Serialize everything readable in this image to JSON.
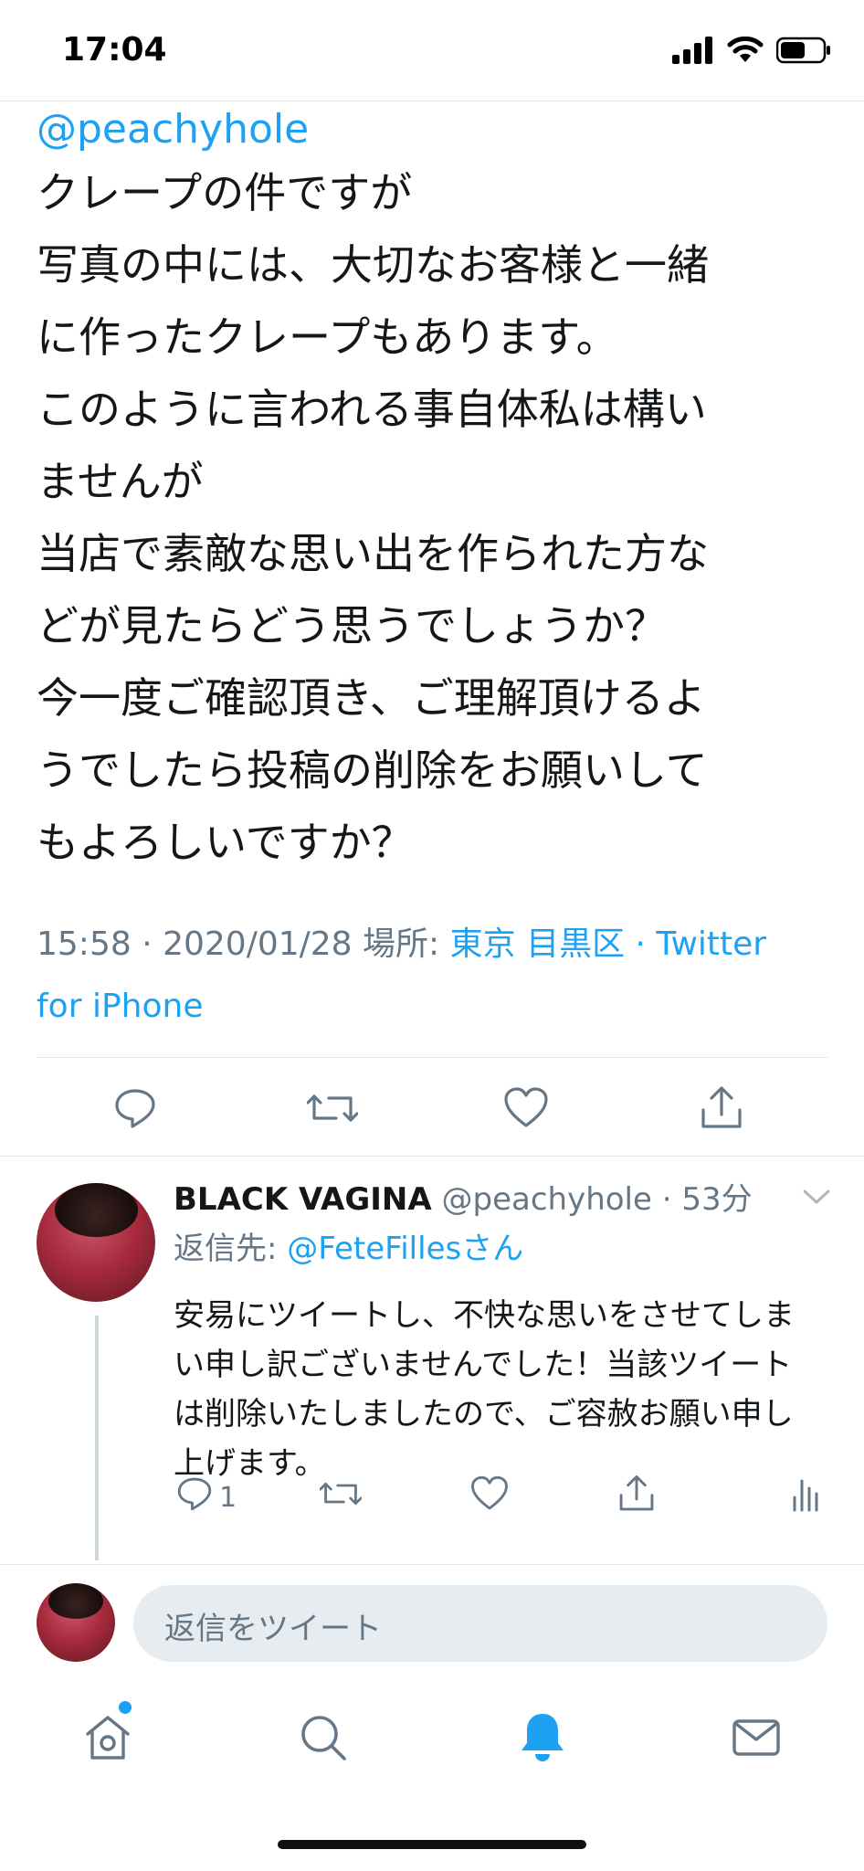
{
  "status_bar": {
    "time": "17:04",
    "signal_icon": "cellular-signal-icon",
    "wifi_icon": "wifi-icon",
    "battery_icon": "battery-icon"
  },
  "tweet": {
    "mention": "@peachyhole",
    "text": "クレープの件ですが\n写真の中には、大切なお客様と一緒\nに作ったクレープもあります。\nこのように言われる事自体私は構い\nませんが\n当店で素敵な思い出を作られた方な\nどが見たらどう思うでしょうか？\n今一度ご確認頂き、ご理解頂けるよ\nうでしたら投稿の削除をお願いして\nもよろしいですか？",
    "timestamp": "15:58 · 2020/01/28",
    "location_prefix": "場所:",
    "location": "東京 目黒区",
    "source": "· Twitter for iPhone",
    "actions": {
      "reply_icon": "reply-icon",
      "retweet_icon": "retweet-icon",
      "like_icon": "like-icon",
      "share_icon": "share-icon"
    }
  },
  "reply": {
    "name": "BLACK VAGINA",
    "handle": "@peachyhole",
    "time": "· 53分",
    "reply_to_prefix": "返信先:",
    "reply_to_handle": "@FeteFillesさん",
    "text": "安易にツイートし、不快な思いをさせてしま\nい申し訳ございませんでした！当該ツイート\nは削除いたしましたので、ご容赦お願い申し\n上げます。",
    "reply_count": "1"
  },
  "compose": {
    "placeholder": "返信をツイート"
  },
  "tab_bar": {
    "home_icon": "home-icon",
    "search_icon": "search-icon",
    "notifications_icon": "notifications-icon",
    "messages_icon": "messages-icon"
  },
  "colors": {
    "accent": "#1da1f2",
    "secondary_text": "#657786",
    "divider": "#e1e8ed"
  }
}
